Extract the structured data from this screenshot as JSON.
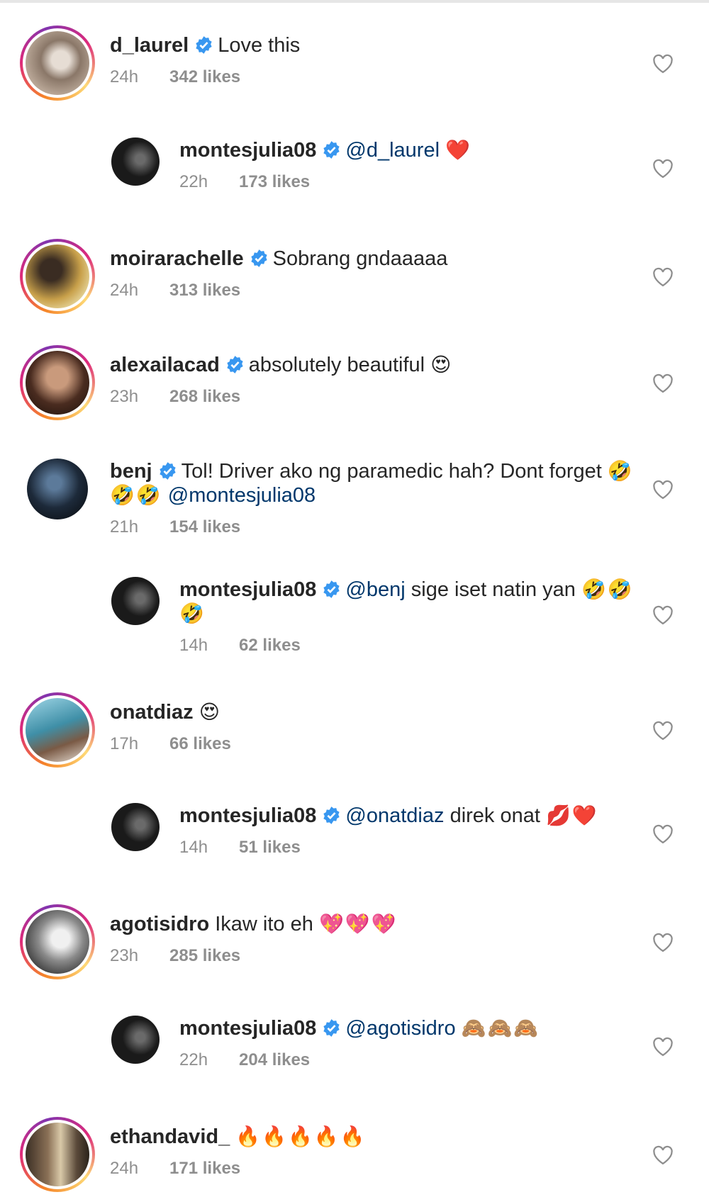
{
  "comments": [
    {
      "username": "d_laurel",
      "verified": true,
      "text": "Love this",
      "mention": "",
      "emoji": "",
      "time": "24h",
      "likes": "342 likes",
      "is_reply": false,
      "avatar_color": "#a58c7a"
    },
    {
      "username": "montesjulia08",
      "verified": true,
      "text": "",
      "mention": "@d_laurel",
      "emoji": "❤️",
      "time": "22h",
      "likes": "173 likes",
      "is_reply": true,
      "avatar_color": "#1a1a1a"
    },
    {
      "username": "moirarachelle",
      "verified": true,
      "text": "Sobrang gndaaaaa",
      "mention": "",
      "emoji": "",
      "time": "24h",
      "likes": "313 likes",
      "is_reply": false,
      "avatar_color": "#b4966a"
    },
    {
      "username": "alexailacad",
      "verified": true,
      "text": "absolutely beautiful",
      "mention": "",
      "emoji": "😍",
      "time": "23h",
      "likes": "268 likes",
      "is_reply": false,
      "avatar_color": "#5a3a2e"
    },
    {
      "username": "benj",
      "verified": true,
      "text": "Tol! Driver ako ng paramedic hah? Dont forget",
      "text_line2": "@montesjulia08",
      "emoji": "🤣",
      "emoji_line2": "🤣🤣",
      "time": "21h",
      "likes": "154 likes",
      "is_reply": false,
      "avatar_color": "#1d2a3a"
    },
    {
      "username": "montesjulia08",
      "verified": true,
      "text": "sige iset natin yan",
      "mention": "@benj",
      "emoji": "🤣🤣",
      "emoji_line2": "🤣",
      "time": "14h",
      "likes": "62 likes",
      "is_reply": true,
      "avatar_color": "#1a1a1a"
    },
    {
      "username": "onatdiaz",
      "verified": false,
      "text": "",
      "mention": "",
      "emoji": "😍",
      "time": "17h",
      "likes": "66 likes",
      "is_reply": false,
      "avatar_color": "#3f8fa7"
    },
    {
      "username": "montesjulia08",
      "verified": true,
      "text": "direk onat",
      "mention": "@onatdiaz",
      "emoji": "💋❤️",
      "time": "14h",
      "likes": "51 likes",
      "is_reply": true,
      "avatar_color": "#1a1a1a"
    },
    {
      "username": "agotisidro",
      "verified": false,
      "text": "Ikaw ito eh",
      "mention": "",
      "emoji": "💖💖💖",
      "time": "23h",
      "likes": "285 likes",
      "is_reply": false,
      "avatar_color": "#6b6b6b"
    },
    {
      "username": "montesjulia08",
      "verified": true,
      "text": "",
      "mention": "@agotisidro",
      "emoji": "🙈🙈🙈",
      "time": "22h",
      "likes": "204 likes",
      "is_reply": true,
      "avatar_color": "#1a1a1a"
    },
    {
      "username": "ethandavid_",
      "verified": false,
      "text": "",
      "mention": "",
      "emoji": "🔥🔥🔥🔥🔥",
      "time": "24h",
      "likes": "171 likes",
      "is_reply": false,
      "avatar_color": "#5b4a3a"
    }
  ],
  "colors": {
    "verified": "#3897f0",
    "heart_outline": "#8e8e8e",
    "meta": "#8e8e8e",
    "mention": "#00376b"
  },
  "icons": {
    "verified": "verified-badge-icon",
    "like": "heart-outline-icon"
  }
}
